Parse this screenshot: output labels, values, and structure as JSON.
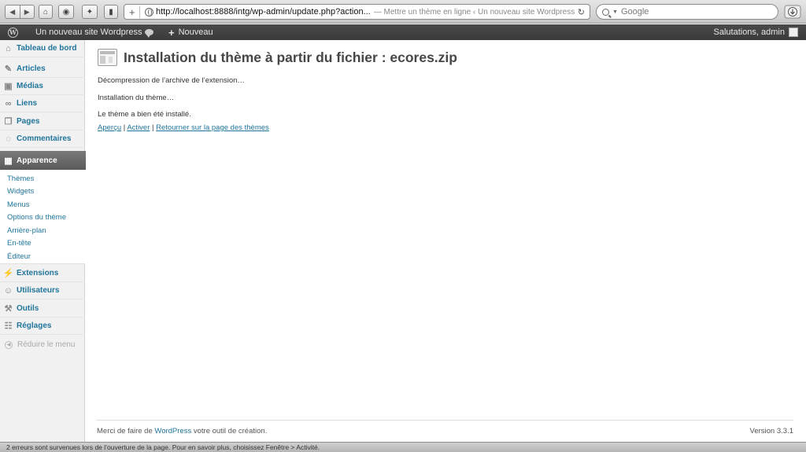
{
  "browser": {
    "url": "http://localhost:8888/intg/wp-admin/update.php?action...",
    "page_title": "— Mettre un thème en ligne ‹ Un nouveau site Wordpress — Wor...",
    "search_placeholder": "Google",
    "status": "2 erreurs sont survenues lors de l’ouverture de la page. Pour en savoir plus, choisissez Fenêtre > Activité."
  },
  "adminbar": {
    "site_name": "Un nouveau site Wordpress",
    "new_label": "Nouveau",
    "greeting": "Salutations, admin"
  },
  "sidebar": {
    "items": [
      {
        "label": "Tableau de bord",
        "icon": "dashboard-icon"
      },
      {
        "label": "Articles",
        "icon": "pushpin-icon"
      },
      {
        "label": "Médias",
        "icon": "media-icon"
      },
      {
        "label": "Liens",
        "icon": "link-icon"
      },
      {
        "label": "Pages",
        "icon": "pages-icon"
      },
      {
        "label": "Commentaires",
        "icon": "comment-icon"
      },
      {
        "label": "Apparence",
        "icon": "appearance-icon"
      },
      {
        "label": "Extensions",
        "icon": "plugin-icon"
      },
      {
        "label": "Utilisateurs",
        "icon": "users-icon"
      },
      {
        "label": "Outils",
        "icon": "tools-icon"
      },
      {
        "label": "Réglages",
        "icon": "settings-icon"
      }
    ],
    "submenu": [
      "Thèmes",
      "Widgets",
      "Menus",
      "Options du thème",
      "Arrière-plan",
      "En-tête",
      "Éditeur"
    ],
    "collapse_label": "Réduire le menu"
  },
  "main": {
    "title": "Installation du thème à partir du fichier : ecores.zip",
    "messages": [
      "Décompression de l’archive de l’extension…",
      "Installation du thème…",
      "Le thème a bien été installé."
    ],
    "actions": {
      "preview": "Aperçu",
      "activate": "Activer",
      "back": "Retourner sur la page des thèmes",
      "separator": "|"
    }
  },
  "footer": {
    "thanks_prefix": "Merci de faire de",
    "wordpress_link": "WordPress",
    "thanks_suffix": "votre outil de création.",
    "version": "Version 3.3.1"
  }
}
